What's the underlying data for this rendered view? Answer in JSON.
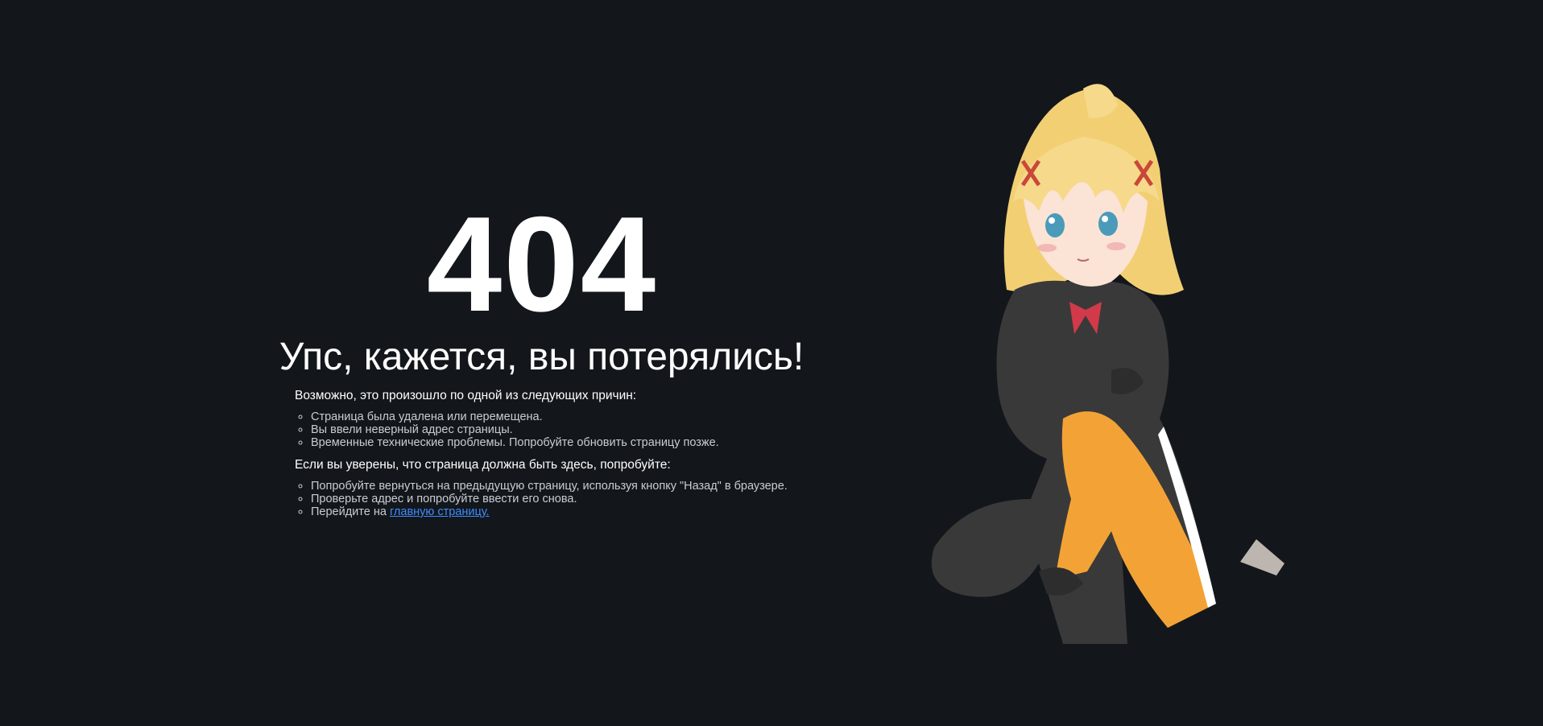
{
  "error": {
    "code": "404",
    "headline": "Упс, кажется, вы потерялись!"
  },
  "reasons": {
    "title": "Возможно, это произошло по одной из следующих причин:",
    "items": [
      "Страница была удалена или перемещена.",
      "Вы ввели неверный адрес страницы.",
      "Временные технические проблемы. Попробуйте обновить страницу позже."
    ]
  },
  "suggestions": {
    "title": "Если вы уверены, что страница должна быть здесь, попробуйте:",
    "items": [
      "Попробуйте вернуться на предыдущую страницу, используя кнопку \"Назад\" в браузере.",
      "Проверьте адрес и попробуйте ввести его снова."
    ],
    "home_prefix": "Перейдите на ",
    "home_link": "главную страницу."
  },
  "illustration": {
    "icon": "anime-girl-illustration"
  },
  "colors": {
    "background": "#13171b",
    "text": "#ffffff",
    "muted_text": "#c9cdd1",
    "link": "#3d8cff"
  }
}
